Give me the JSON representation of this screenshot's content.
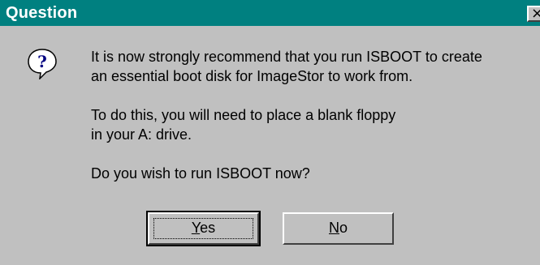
{
  "window": {
    "title": "Question",
    "close_glyph": "×"
  },
  "icon": {
    "name": "question-icon",
    "glyph": "?"
  },
  "message": {
    "paragraph1": "It is now strongly recommend that you run ISBOOT to create\nan essential boot disk for ImageStor to work from.",
    "paragraph2": "To do this, you will need to place a blank floppy\nin your A: drive.",
    "paragraph3": "Do you wish to run ISBOOT now?"
  },
  "buttons": {
    "yes": {
      "accel": "Y",
      "rest": "es"
    },
    "no": {
      "accel": "N",
      "rest": "o"
    }
  },
  "colors": {
    "titlebar": "#008080",
    "face": "#c0c0c0",
    "icon_blue": "#000080"
  }
}
